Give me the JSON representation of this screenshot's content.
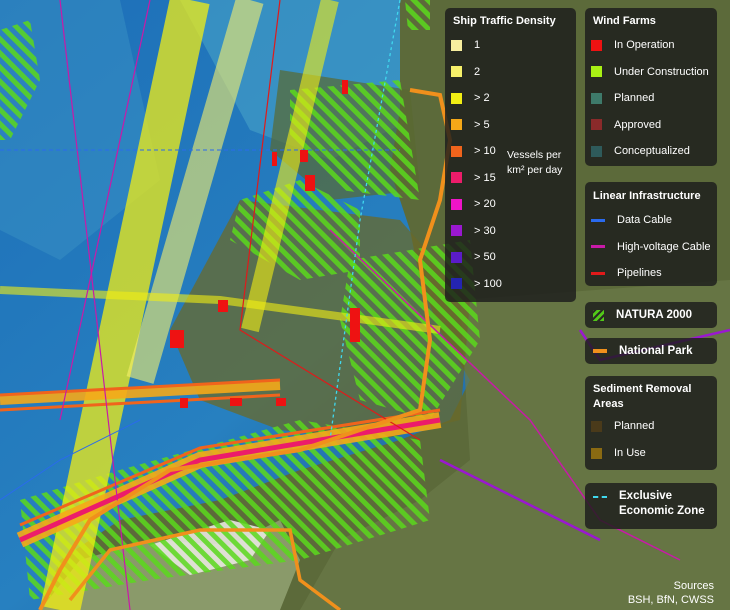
{
  "legend": {
    "traffic": {
      "title": "Ship Traffic Density",
      "unit_line1": "Vessels per",
      "unit_line2": "km² per day",
      "items": [
        {
          "label": "1",
          "color": "#f7ee9f"
        },
        {
          "label": "2",
          "color": "#f6f06a"
        },
        {
          "label": "> 2",
          "color": "#f2ee14"
        },
        {
          "label": "> 5",
          "color": "#f5a818"
        },
        {
          "label": "> 10",
          "color": "#f0641c"
        },
        {
          "label": "> 15",
          "color": "#ec1c6a"
        },
        {
          "label": "> 20",
          "color": "#ef14c8"
        },
        {
          "label": "> 30",
          "color": "#9a18d0"
        },
        {
          "label": "> 50",
          "color": "#5a1cc8"
        },
        {
          "label": "> 100",
          "color": "#2424b0"
        }
      ]
    },
    "windfarms": {
      "title": "Wind Farms",
      "items": [
        {
          "label": "In Operation",
          "color": "#ee1212"
        },
        {
          "label": "Under Construction",
          "color": "#a8f014"
        },
        {
          "label": "Planned",
          "color": "#3e7a6a"
        },
        {
          "label": "Approved",
          "color": "#8a2a2a"
        },
        {
          "label": "Conceptualized",
          "color": "#2e5a5a"
        }
      ]
    },
    "linear": {
      "title": "Linear Infrastructure",
      "items": [
        {
          "label": "Data Cable",
          "color": "#2a6aee"
        },
        {
          "label": "High-voltage Cable",
          "color": "#c81aa8"
        },
        {
          "label": "Pipelines",
          "color": "#e01a1a"
        }
      ]
    },
    "natura": {
      "label": "NATURA 2000",
      "color": "#52c818"
    },
    "national_park": {
      "label": "National Park",
      "color": "#f0901c"
    },
    "sediment": {
      "title_line1": "Sediment Removal",
      "title_line2": "Areas",
      "items": [
        {
          "label": "Planned",
          "color": "#4a3a1a"
        },
        {
          "label": "In Use",
          "color": "#8a6a12"
        }
      ]
    },
    "eez": {
      "label_line1": "Exclusive",
      "label_line2": "Economic Zone",
      "color": "#40d8ee"
    }
  },
  "sources": {
    "line1": "Sources",
    "line2": "BSH, BfN, CWSS"
  }
}
